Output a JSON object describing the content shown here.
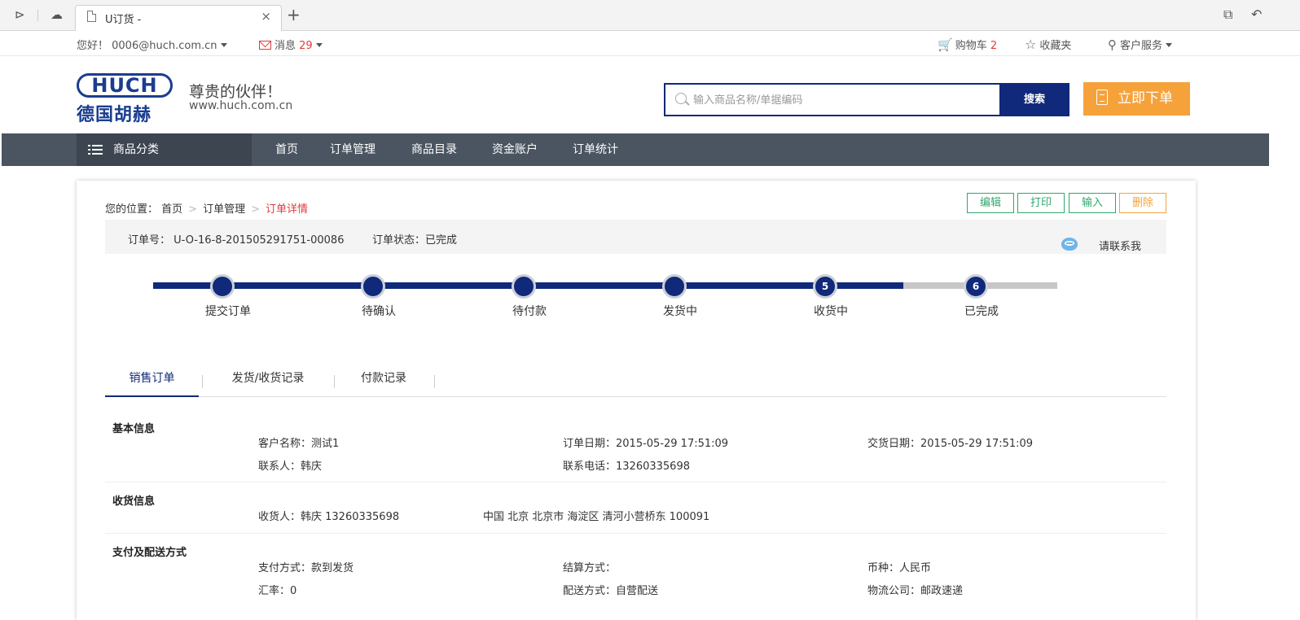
{
  "browser": {
    "tab_title": "U订货 -",
    "close_glyph": "×",
    "new_tab_glyph": "+"
  },
  "topbar": {
    "greeting": "您好！ 0006@huch.com.cn",
    "messages_label": "消息",
    "messages_count": "29",
    "cart_label": "购物车",
    "cart_count": "2",
    "favorites_label": "收藏夹",
    "service_label": "客户服务"
  },
  "header": {
    "logo_text": "HUCH",
    "logo_cn": "德国胡赫",
    "slogan": "尊贵的伙伴！",
    "site": "www.huch.com.cn",
    "search_placeholder": "输入商品名称/单据编码",
    "search_button": "搜索",
    "order_button": "立即下单"
  },
  "nav": {
    "category_label": "商品分类",
    "links": [
      "首页",
      "订单管理",
      "商品目录",
      "资金账户",
      "订单统计"
    ]
  },
  "breadcrumb": {
    "prefix": "您的位置：",
    "items": [
      "首页",
      "订单管理"
    ],
    "current": "订单详情",
    "separator": ">"
  },
  "actions": [
    "编辑",
    "打印",
    "输入",
    "删除"
  ],
  "order": {
    "number": "订单号： U-O-16-8-201505291751-00086",
    "status": "订单状态：已完成",
    "contact": "请联系我"
  },
  "progress": {
    "completed_fraction": 0.83,
    "steps": [
      {
        "label": "提交订单",
        "num": ""
      },
      {
        "label": "待确认",
        "num": ""
      },
      {
        "label": "待付款",
        "num": ""
      },
      {
        "label": "发货中",
        "num": ""
      },
      {
        "label": "收货中",
        "num": "5"
      },
      {
        "label": "已完成",
        "num": "6"
      }
    ]
  },
  "tabs": [
    "销售订单",
    "发货/收货记录",
    "付款记录"
  ],
  "sections": {
    "basic": {
      "title": "基本信息",
      "customer": "客户名称：测试1",
      "order_date": "订单日期：2015-05-29 17:51:09",
      "delivery_date": "交货日期：2015-05-29 17:51:09",
      "contact": "联系人：韩庆",
      "phone": "联系电话：13260335698"
    },
    "shipping": {
      "title": "收货信息",
      "receiver": "收货人：韩庆  13260335698",
      "address": "中国 北京 北京市 海淀区 清河小营桥东  100091"
    },
    "payment": {
      "title": "支付及配送方式",
      "pay_method": "支付方式：款到发货",
      "settle": "结算方式：",
      "currency": "币种：人民币",
      "rate": "汇率：0",
      "delivery": "配送方式：自营配送",
      "logistics": "物流公司：邮政速递"
    }
  }
}
